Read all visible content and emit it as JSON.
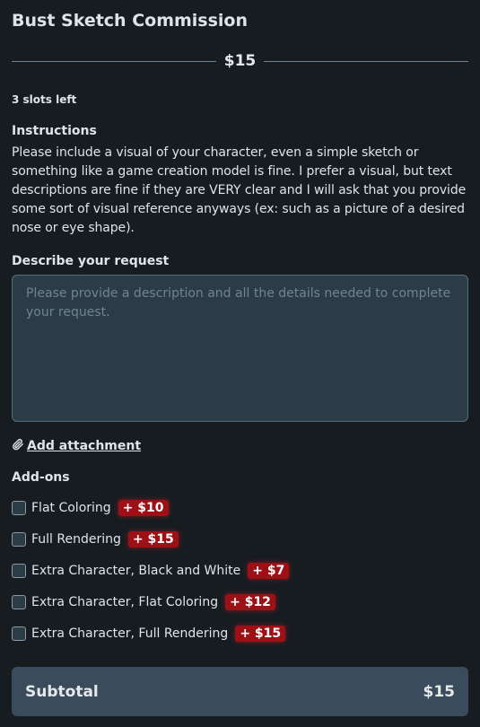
{
  "title": "Bust Sketch Commission",
  "price": "$15",
  "slots": "3 slots left",
  "instructions": {
    "label": "Instructions",
    "text": "Please include a visual of your character, even a simple sketch or something like a game creation model is fine. I prefer a visual, but text descriptions are fine if they are VERY clear and I will ask that you provide some sort of visual reference anyways (ex: such as a picture of a desired nose or eye shape)."
  },
  "request": {
    "label": "Describe your request",
    "placeholder": "Please provide a description and all the details needed to complete your request."
  },
  "attachment": {
    "label": "Add attachment",
    "icon": "paperclip-icon"
  },
  "addons": {
    "label": "Add-ons",
    "items": [
      {
        "name": "Flat Coloring",
        "price": "+ $10",
        "checked": false
      },
      {
        "name": "Full Rendering",
        "price": "+ $15",
        "checked": false
      },
      {
        "name": "Extra Character, Black and White",
        "price": "+ $7",
        "checked": false
      },
      {
        "name": "Extra Character, Flat Coloring",
        "price": "+ $12",
        "checked": false
      },
      {
        "name": "Extra Character, Full Rendering",
        "price": "+ $15",
        "checked": false
      }
    ]
  },
  "subtotal": {
    "label": "Subtotal",
    "value": "$15"
  },
  "colors": {
    "background": "#171c21",
    "badge": "#9d1016",
    "panel": "#3a4c5b",
    "input": "#2c3c47"
  }
}
